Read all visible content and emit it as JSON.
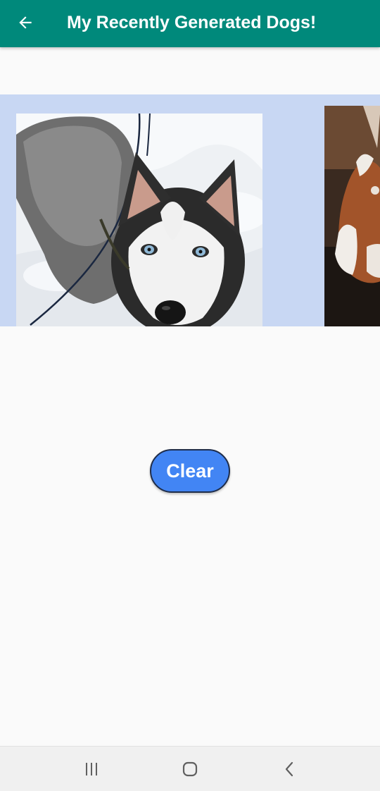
{
  "appbar": {
    "title": "My Recently Generated Dogs!",
    "color": "#00897b",
    "back_icon": "arrow-left-icon"
  },
  "gallery": {
    "background": "#c8d7f3",
    "images": [
      {
        "alt": "husky-photo",
        "breed": "siberian husky"
      },
      {
        "alt": "spaniel-photo",
        "breed": "cavalier king charles spaniel"
      }
    ]
  },
  "actions": {
    "clear_label": "Clear",
    "clear_color": "#4285f4"
  },
  "system_nav": {
    "recents_icon": "recents-icon",
    "home_icon": "home-icon",
    "back_icon": "chevron-left-icon"
  }
}
